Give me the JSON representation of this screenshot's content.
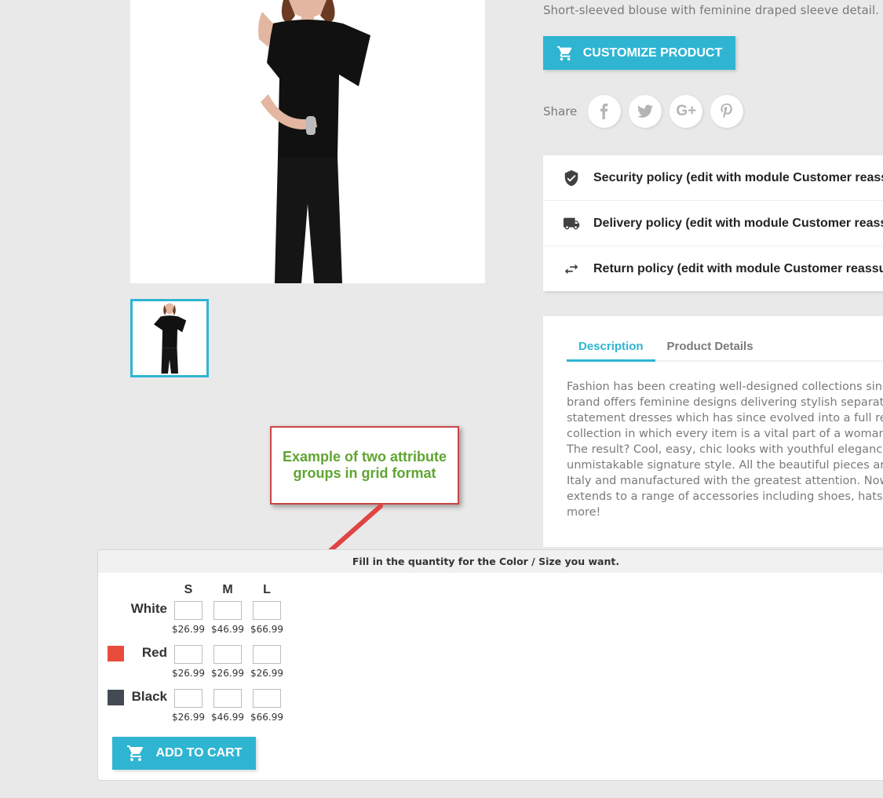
{
  "product": {
    "short_description": "Short-sleeved blouse with feminine draped sleeve detail.",
    "customize_label": "CUSTOMIZE PRODUCT"
  },
  "share": {
    "label": "Share",
    "networks": [
      {
        "name": "facebook",
        "glyph": "f"
      },
      {
        "name": "twitter",
        "glyph": "t"
      },
      {
        "name": "google-plus",
        "glyph": "G+"
      },
      {
        "name": "pinterest",
        "glyph": "P"
      }
    ]
  },
  "reassurance": [
    {
      "icon": "shield-check-icon",
      "text": "Security policy (edit with module Customer reassu"
    },
    {
      "icon": "truck-icon",
      "text": "Delivery policy (edit with module Customer reassu"
    },
    {
      "icon": "swap-arrows-icon",
      "text": "Return policy (edit with module Customer reassur"
    }
  ],
  "tabs": [
    {
      "label": "Description",
      "active": true
    },
    {
      "label": "Product Details",
      "active": false
    }
  ],
  "description_lines": [
    "Fashion has been creating well-designed collections since",
    "brand offers feminine designs delivering stylish separates",
    "statement dresses which has since evolved into a full read",
    "collection in which every item is a vital part of a woman's v",
    "The result? Cool, easy, chic looks with youthful elegance ar",
    "unmistakable signature style. All the beautiful pieces are m",
    "Italy and manufactured with the greatest attention. Now F",
    "extends to a range of accessories including shoes, hats, be",
    "more!"
  ],
  "callout": {
    "text": "Example of two attribute groups in grid format"
  },
  "grid": {
    "header": "Fill in the quantity for the Color / Size you want.",
    "sizes": [
      "S",
      "M",
      "L"
    ],
    "rows": [
      {
        "color": "White",
        "swatch": null,
        "prices": [
          "$26.99",
          "$46.99",
          "$66.99"
        ]
      },
      {
        "color": "Red",
        "swatch": "#e84c3d",
        "prices": [
          "$26.99",
          "$26.99",
          "$26.99"
        ]
      },
      {
        "color": "Black",
        "swatch": "#434a54",
        "prices": [
          "$26.99",
          "$46.99",
          "$66.99"
        ]
      }
    ],
    "add_to_cart_label": "ADD TO CART"
  },
  "colors": {
    "accent": "#2fb5d2",
    "callout_border": "#c94646",
    "callout_text": "#5fa531",
    "arrow": "#e04444"
  }
}
